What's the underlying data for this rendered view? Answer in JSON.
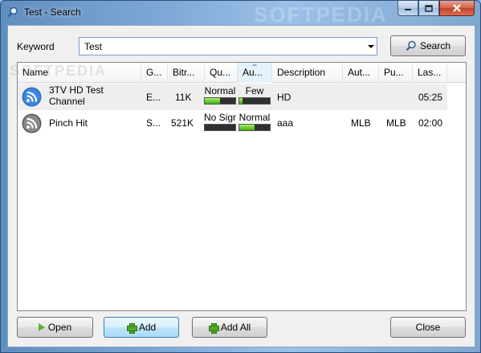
{
  "window": {
    "title": "Test - Search",
    "watermark": "SOFTPEDIA"
  },
  "search": {
    "keyword_label": "Keyword",
    "keyword_value": "Test",
    "search_button": "Search"
  },
  "list": {
    "watermark": "SOFTPEDIA",
    "columns": [
      "Name",
      "G...",
      "Bitr...",
      "Qu...",
      "Au...",
      "Description",
      "Aut...",
      "Pu...",
      "Las..."
    ],
    "rows": [
      {
        "name": "3TV HD Test Channel",
        "genre": "E...",
        "bitrate": "11K",
        "quality_label": "Normal",
        "quality_level": 0.5,
        "audience_label": "Few",
        "audience_level": 0.1,
        "description": "HD",
        "author": "",
        "publisher": "",
        "last": "05:25"
      },
      {
        "name": "Pinch Hit",
        "genre": "S...",
        "bitrate": "521K",
        "quality_label": "No Signal",
        "quality_level": 0.0,
        "audience_label": "Normal",
        "audience_level": 0.5,
        "description": "aaa",
        "author": "MLB",
        "publisher": "MLB",
        "last": "02:00"
      }
    ]
  },
  "buttons": {
    "open": "Open",
    "add": "Add",
    "add_all": "Add All",
    "close": "Close"
  },
  "colors": {
    "meter_fill": "#3fb10f",
    "meter_empty": "#2f2f2f",
    "selection": "#eeeeee"
  }
}
